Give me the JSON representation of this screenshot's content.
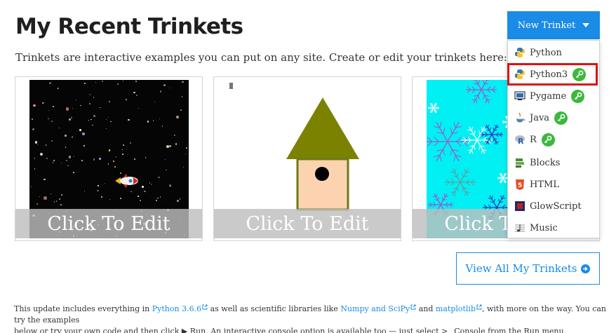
{
  "header": {
    "title": "My Recent Trinkets",
    "subtitle": "Trinkets are interactive examples you can put on any site. Create or edit your trinkets here:"
  },
  "cards": [
    {
      "overlay_label": "Click To Edit"
    },
    {
      "overlay_label": "Click To Edit"
    },
    {
      "overlay_label": "Click To Edit"
    }
  ],
  "new_trinket": {
    "label": "New Trinket",
    "items": [
      {
        "label": "Python",
        "icon": "python-icon",
        "premium": false
      },
      {
        "label": "Python3",
        "icon": "python-icon",
        "premium": true,
        "highlighted": true
      },
      {
        "label": "Pygame",
        "icon": "pygame-icon",
        "premium": true
      },
      {
        "label": "Java",
        "icon": "java-icon",
        "premium": true
      },
      {
        "label": "R",
        "icon": "r-icon",
        "premium": true
      },
      {
        "label": "Blocks",
        "icon": "blocks-icon",
        "premium": false
      },
      {
        "label": "HTML",
        "icon": "html5-icon",
        "premium": false
      },
      {
        "label": "GlowScript",
        "icon": "glowscript-icon",
        "premium": false
      },
      {
        "label": "Music",
        "icon": "music-icon",
        "premium": false
      }
    ]
  },
  "view_all": {
    "label": "View All My Trinkets"
  },
  "footer": {
    "text1": "This update includes everything in ",
    "link1": "Python 3.6.6",
    "text2": " as well as scientific libraries like ",
    "link2": "Numpy and SciPy",
    "text3": " and ",
    "link3": "matplotlib",
    "text4": ", with more on the way. You can try the examples",
    "text5": "below or try your own code and then click ▶ Run. An interactive console option is available too — just select >_ Console from the Run menu."
  },
  "colors": {
    "accent": "#1a8be6",
    "highlight": "#e01010",
    "premium_key": "#3cb83c"
  }
}
